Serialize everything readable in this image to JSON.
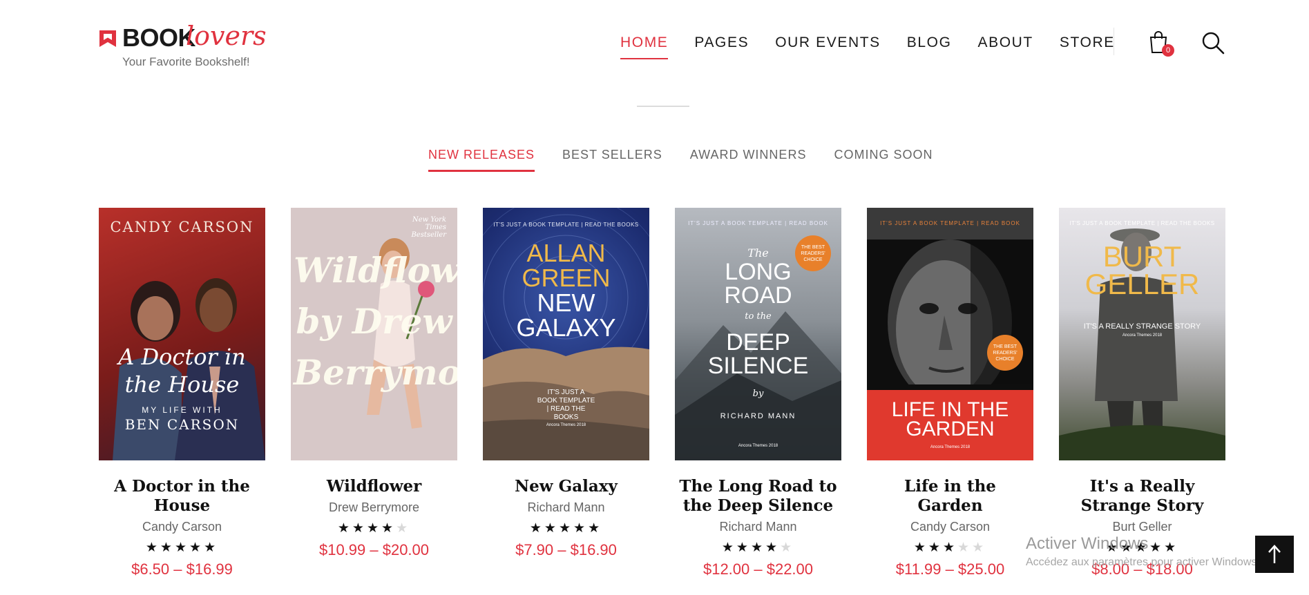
{
  "header": {
    "logo_book": "BOOK",
    "logo_lovers": "lovers",
    "logo_tagline": "Your Favorite Bookshelf!",
    "nav": [
      "HOME",
      "PAGES",
      "OUR EVENTS",
      "BLOG",
      "ABOUT",
      "STORE"
    ],
    "active_nav": "HOME",
    "cart_count": "0"
  },
  "tabs": [
    "NEW RELEASES",
    "BEST SELLERS",
    "AWARD WINNERS",
    "COMING SOON"
  ],
  "active_tab": "NEW RELEASES",
  "books": [
    {
      "title": "A Doctor in the House",
      "author": "Candy Carson",
      "rating": 5,
      "price": "$6.50 – $16.99",
      "cover": {
        "top": "CANDY CARSON",
        "script": "A Doctor in the House",
        "sub": "MY LIFE WITH",
        "bottom": "BEN CARSON"
      }
    },
    {
      "title": "Wildflower",
      "author": "Drew Berrymore",
      "rating": 4,
      "price": "$10.99 – $20.00",
      "cover": {
        "badge": "New York Times Bestseller",
        "script": "Wildflower by Drew Berrymore"
      }
    },
    {
      "title": "New Galaxy",
      "author": "Richard Mann",
      "rating": 5,
      "price": "$7.90 – $16.90",
      "cover": {
        "header": "IT'S JUST A BOOK TEMPLATE | READ THE BOOKS",
        "line1": "ALLAN",
        "line2": "GREEN",
        "line3": "NEW",
        "line4": "GALAXY",
        "blurb": "IT'S JUST A BOOK TEMPLATE | READ THE BOOKS",
        "footer": "Ancora Themes 2018"
      }
    },
    {
      "title": "The Long Road to the Deep Silence",
      "author": "Richard Mann",
      "rating": 4,
      "price": "$12.00 – $22.00",
      "cover": {
        "header": "IT'S JUST A BOOK TEMPLATE  |  READ BOOK",
        "the": "The",
        "line1": "LONG",
        "line2": "ROAD",
        "to": "to the",
        "line3": "DEEP",
        "line4": "SILENCE",
        "by": "by",
        "author": "RICHARD MANN",
        "badge": "THE BEST READERS' CHOICE",
        "footer": "Ancora Themes 2018"
      }
    },
    {
      "title": "Life in the Garden",
      "author": "Candy Carson",
      "rating": 3,
      "price": "$11.99 – $25.00",
      "cover": {
        "header": "IT'S JUST A BOOK TEMPLATE  |  READ BOOK",
        "line1": "LIFE IN THE",
        "line2": "GARDEN",
        "badge": "THE BEST READERS' CHOICE",
        "footer": "Ancora Themes 2018"
      }
    },
    {
      "title": "It's a Really Strange Story",
      "author": "Burt Geller",
      "rating": 5,
      "price": "$8.00 – $18.00",
      "cover": {
        "header": "IT'S JUST A BOOK TEMPLATE | READ THE BOOKS",
        "line1": "BURT",
        "line2": "GELLER",
        "sub": "IT'S A REALLY STRANGE STORY",
        "footer": "Ancora Themes 2018"
      }
    }
  ],
  "watermark": {
    "line1": "Activer Windows",
    "line2": "Accédez aux paramètres pour activer Windows."
  },
  "colors": {
    "accent": "#e0323f",
    "text": "#111111",
    "muted": "#666666"
  }
}
